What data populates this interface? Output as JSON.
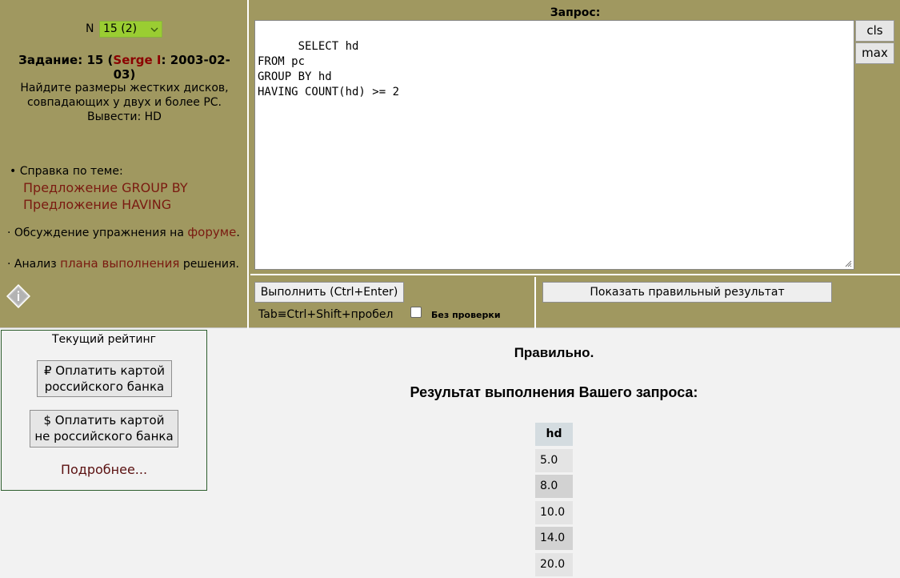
{
  "task_selector": {
    "label": "N",
    "value": "15 (2)"
  },
  "task": {
    "title_prefix": "Задание: 15 (",
    "author": "Serge I",
    "title_suffix": ": 2003-02-03)",
    "text": "Найдите размеры жестких дисков, совпадающих у двух и более PC. Вывести: HD"
  },
  "help": {
    "label": "• Справка по теме:",
    "links": [
      "Предложение GROUP BY",
      "Предложение HAVING"
    ]
  },
  "forum": {
    "prefix": "·  Обсуждение упражнения на ",
    "link": "форуме",
    "suffix": "."
  },
  "plan": {
    "prefix": "·  Анализ ",
    "link": "плана выполнения",
    "suffix": " решения."
  },
  "query": {
    "label": "Запрос:",
    "text": "SELECT hd\nFROM pc\nGROUP BY hd\nHAVING COUNT(hd) >= 2",
    "cls_label": "cls",
    "max_label": "max"
  },
  "run": {
    "button_label": "Выполнить (Ctrl+Enter)",
    "tab_hint": "Tab≡Ctrl+Shift+пробел",
    "nocheck_label": "Без проверки",
    "show_result_label": "Показать правильный результат"
  },
  "rating": {
    "title": "Текущий рейтинг",
    "pay_rus_line1": "₽ Оплатить картой",
    "pay_rus_line2": "российского банка",
    "pay_nonrus_line1": "$ Оплатить картой",
    "pay_nonrus_line2": "не российского банка",
    "more_link": "Подробнее..."
  },
  "result": {
    "status": "Правильно.",
    "title": "Результат выполнения Вашего запроса:",
    "column": "hd",
    "rows": [
      "5.0",
      "8.0",
      "10.0",
      "14.0",
      "20.0"
    ]
  }
}
